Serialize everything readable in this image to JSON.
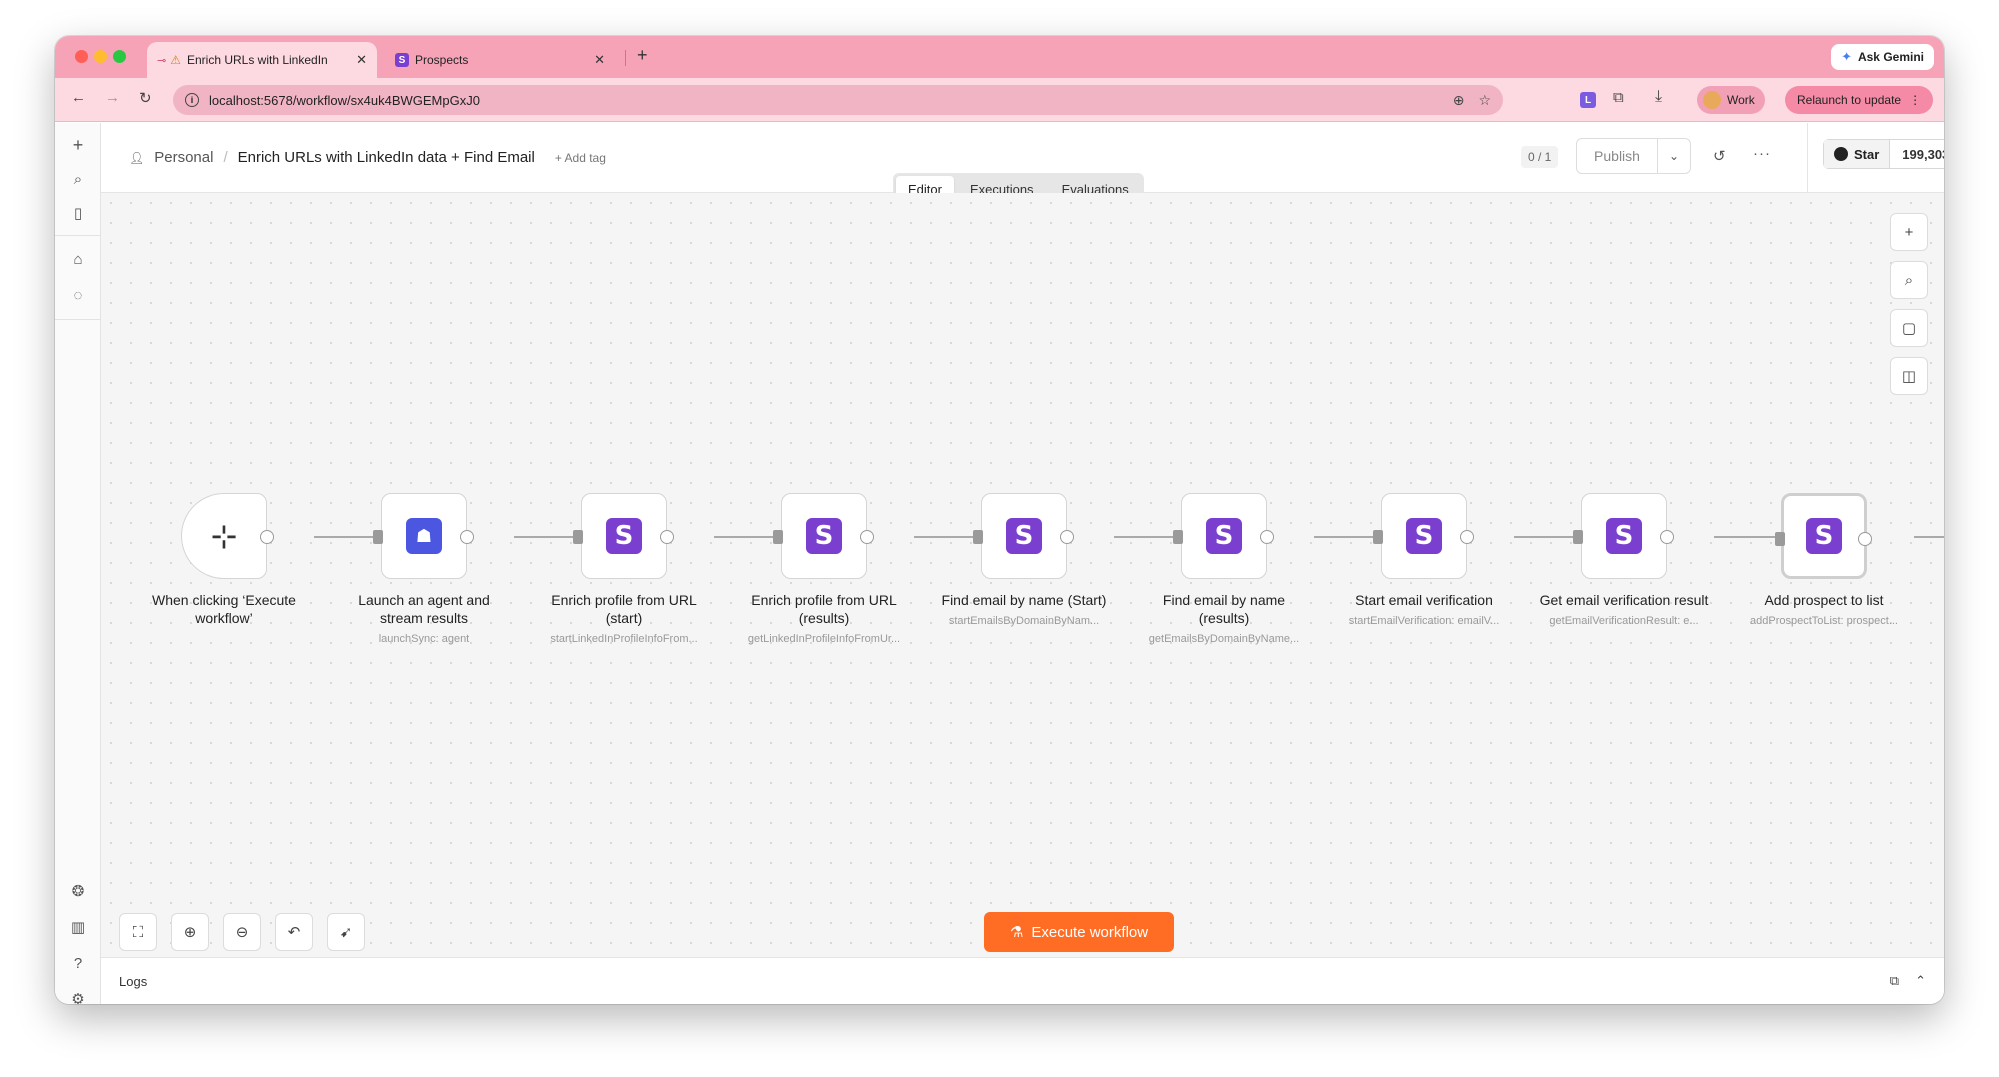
{
  "browser": {
    "tabs": [
      {
        "title": "Enrich URLs with LinkedIn",
        "icon": "n8n-warning-icon",
        "active": true
      },
      {
        "title": "Prospects",
        "icon": "s-logo-icon",
        "active": false
      }
    ],
    "new_tab": "+",
    "ask_gemini": "Ask Gemini",
    "url": "localhost:5678/workflow/sx4uk4BWGEMpGxJ0",
    "extension_badge": "L",
    "profile_label": "Work",
    "relaunch_label": "Relaunch to update",
    "tab_close": "✕"
  },
  "header": {
    "breadcrumb_personal": "Personal",
    "workflow_title": "Enrich URLs with LinkedIn data + Find Email",
    "add_tag": "+ Add tag",
    "counter": "0 / 1",
    "publish_label": "Publish",
    "star_label": "Star",
    "star_count": "199,303"
  },
  "view_tabs": [
    {
      "label": "Editor",
      "active": true
    },
    {
      "label": "Executions",
      "active": false
    },
    {
      "label": "Evaluations",
      "active": false
    }
  ],
  "nodes": [
    {
      "label": "When clicking ‘Execute workflow’",
      "sub": "",
      "icon": "cursor-click-icon"
    },
    {
      "label": "Launch an agent and stream results",
      "sub": "launchSync: agent",
      "icon": "agent-icon"
    },
    {
      "label": "Enrich profile from URL (start)",
      "sub": "startLinkedInProfileInfoFrom...",
      "icon": "s-logo-icon"
    },
    {
      "label": "Enrich profile from URL (results)",
      "sub": "getLinkedInProfileInfoFromUr...",
      "icon": "s-logo-icon"
    },
    {
      "label": "Find email by name (Start)",
      "sub": "startEmailsByDomainByNam...",
      "icon": "s-logo-icon"
    },
    {
      "label": "Find email by name (results)",
      "sub": "getEmailsByDomainByName...",
      "icon": "s-logo-icon"
    },
    {
      "label": "Start email verification",
      "sub": "startEmailVerification: emailV...",
      "icon": "s-logo-icon"
    },
    {
      "label": "Get email verification result",
      "sub": "getEmailVerificationResult: e...",
      "icon": "s-logo-icon"
    },
    {
      "label": "Add prospect to list",
      "sub": "addProspectToList: prospect...",
      "icon": "s-logo-icon"
    }
  ],
  "execute_label": "Execute workflow",
  "logs_label": "Logs",
  "node_logo_letter": "S",
  "colors": {
    "accent": "#ff6d24",
    "chrome_pink": "#f6a3b8",
    "node_purple": "#7b3fd0"
  }
}
